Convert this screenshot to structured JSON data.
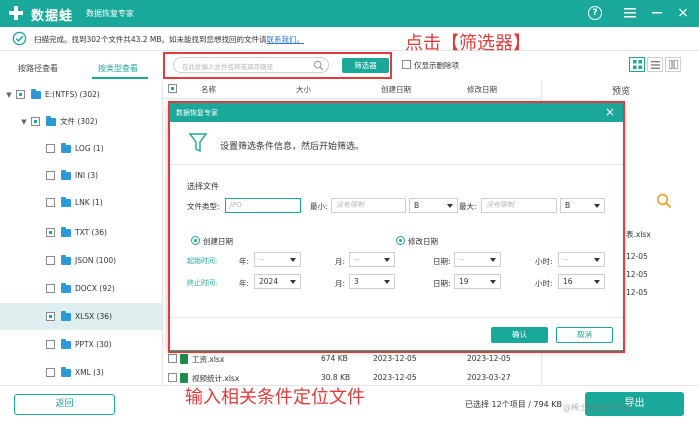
{
  "app": {
    "name": "数据蛙",
    "subtitle": "数据恢复专家",
    "help": "?",
    "close": "×"
  },
  "status": {
    "text": "扫描完成。找到302个文件共43.2 MB。如未能找到您想找回的文件请",
    "link": "联系我们。"
  },
  "view_tabs": {
    "by_path": "按路径查看",
    "by_type": "按类型查看"
  },
  "tree": {
    "drive": {
      "expand": "▼",
      "label": "E:(NTFS) (302)"
    },
    "folder": {
      "expand": "▼",
      "label": "文件 (302)"
    },
    "items": [
      {
        "label": "LOG (1)"
      },
      {
        "label": "INI (3)"
      },
      {
        "label": "LNK (1)"
      },
      {
        "label": "TXT (36)"
      },
      {
        "label": "JSON (100)"
      },
      {
        "label": "DOCX (92)"
      },
      {
        "label": "XLSX (36)"
      },
      {
        "label": "PPTX (30)"
      },
      {
        "label": "XML (3)"
      }
    ]
  },
  "toolbar": {
    "search_placeholder": "在此处输入文件名称或保存路径",
    "filter_button": "筛选器",
    "deleted_only": "仅显示删除项"
  },
  "columns": {
    "name": "名称",
    "size": "大小",
    "created": "创建日期",
    "modified": "修改日期",
    "preview": "预览"
  },
  "files": [
    {
      "name": "工资.xlsx",
      "size": "674 KB",
      "created": "2023-12-05",
      "modified": "2023-12-05"
    },
    {
      "name": "视频统计.xlsx",
      "size": "30.8 KB",
      "created": "2023-12-05",
      "modified": "2023-03-27"
    }
  ],
  "peek": {
    "xlsx": "表.xlsx",
    "d1": "12-05",
    "d2": "12-05",
    "d3": "12-05"
  },
  "annotations": {
    "click_filter": "点击【筛选器】",
    "enter_conditions": "输入相关条件定位文件"
  },
  "dialog": {
    "title": "数据恢复专家",
    "close": "×",
    "tip": "设置筛选条件信息，然后开始筛选。",
    "select_file": "选择文件",
    "file_type_label": "文件类型:",
    "file_type_placeholder": "JPG",
    "min_label": "最小:",
    "min_placeholder": "没有限制",
    "min_unit": "B",
    "max_label": "最大:",
    "max_placeholder": "没有限制",
    "max_unit": "B",
    "created_date": "创建日期",
    "modified_date": "修改日期",
    "start_time": "起始时间:",
    "end_time": "终止时间:",
    "year": "年:",
    "month": "月:",
    "day": "日期:",
    "hour": "小时:",
    "start": {
      "year": "--",
      "month": "--",
      "day": "--",
      "hour": "--"
    },
    "end": {
      "year": "2024",
      "month": "3",
      "day": "19",
      "hour": "16"
    },
    "ok": "确认",
    "cancel": "取消"
  },
  "bottom": {
    "back": "返回",
    "summary": "已选择 12个项目 / 794 KB",
    "export": "导出",
    "watermark": "@稀土掘金技术社区"
  },
  "colors": {
    "accent": "#19a89a",
    "annotation": "#e03c3c",
    "link": "#2a7bd6"
  }
}
